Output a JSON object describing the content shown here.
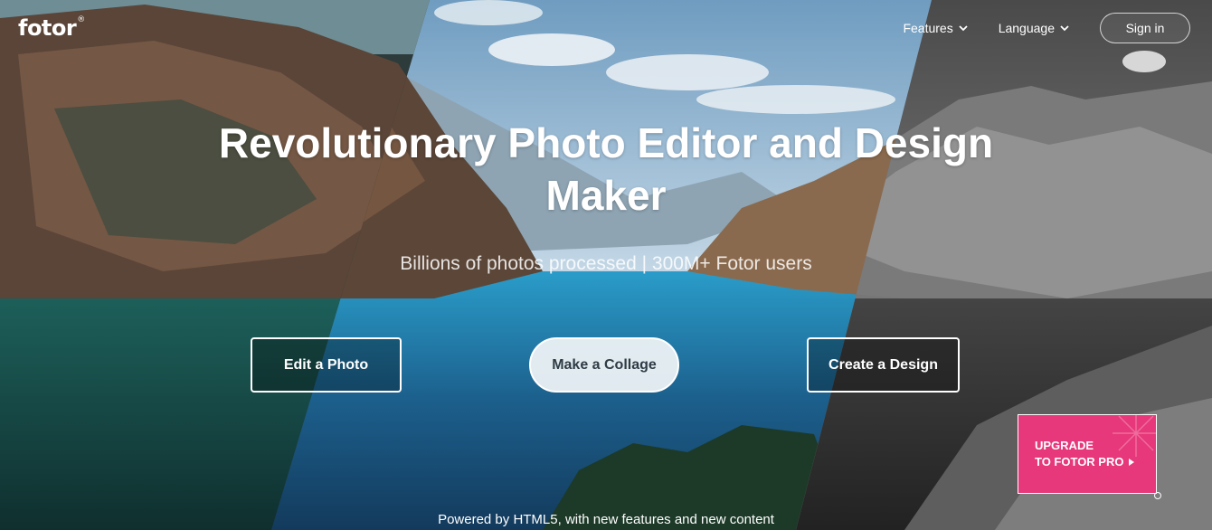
{
  "brand": {
    "logo_text": "fotor",
    "registered_mark": "®"
  },
  "nav": {
    "features_label": "Features",
    "language_label": "Language",
    "signin_label": "Sign in"
  },
  "hero": {
    "title": "Revolutionary Photo Editor and Design Maker",
    "subtitle": "Billions of photos processed | 300M+ Fotor users"
  },
  "actions": {
    "edit_label": "Edit a Photo",
    "collage_label": "Make a Collage",
    "design_label": "Create a Design"
  },
  "promo": {
    "line1": "UPGRADE",
    "line2": "TO FOTOR PRO",
    "color": "#e6387a"
  },
  "footer": {
    "powered_text": "Powered by HTML5, with new features and new content"
  },
  "icons": {
    "features_chevron": "chevron-down-icon",
    "language_chevron": "chevron-down-icon",
    "promo_arrow": "play-arrow-icon"
  }
}
